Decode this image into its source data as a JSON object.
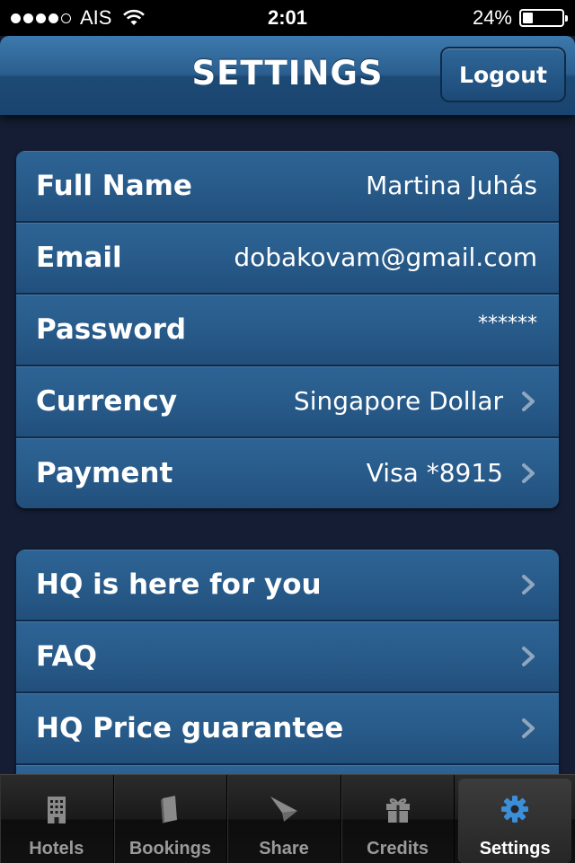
{
  "status_bar": {
    "carrier": "AIS",
    "time": "2:01",
    "battery": "24%",
    "battery_level": 0.24,
    "signal_bars": 4
  },
  "nav": {
    "title": "SETTINGS",
    "logout_label": "Logout"
  },
  "account": [
    {
      "label": "Full Name",
      "value": "Martina Juhás",
      "chevron": false
    },
    {
      "label": "Email",
      "value": "dobakovam@gmail.com",
      "chevron": false
    },
    {
      "label": "Password",
      "value": "******",
      "chevron": false
    },
    {
      "label": "Currency",
      "value": "Singapore Dollar",
      "chevron": true
    },
    {
      "label": "Payment",
      "value": "Visa *8915",
      "chevron": true
    }
  ],
  "info": [
    {
      "label": "HQ is here for you",
      "chevron": true
    },
    {
      "label": "FAQ",
      "chevron": true
    },
    {
      "label": "HQ Price guarantee",
      "chevron": true
    }
  ],
  "tabs": [
    {
      "label": "Hotels",
      "icon": "building-icon",
      "active": false
    },
    {
      "label": "Bookings",
      "icon": "book-icon",
      "active": false
    },
    {
      "label": "Share",
      "icon": "paper-plane-icon",
      "active": false
    },
    {
      "label": "Credits",
      "icon": "gift-icon",
      "active": false
    },
    {
      "label": "Settings",
      "icon": "gear-icon",
      "active": true
    }
  ],
  "colors": {
    "background": "#141d33",
    "row": "#285b8a",
    "active_tab_icon": "#3b8fd8",
    "inactive_tab": "#9a9a9a"
  }
}
